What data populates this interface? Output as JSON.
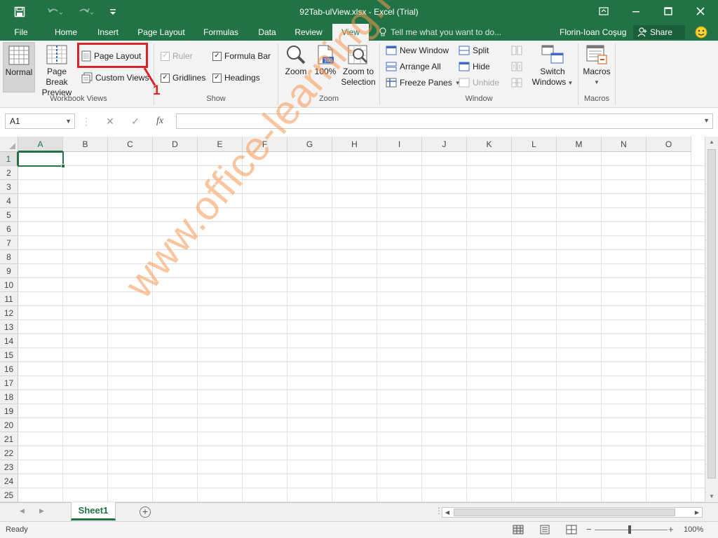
{
  "window": {
    "title": "92Tab-ulView.xlsx - Excel (Trial)"
  },
  "tabs": [
    {
      "label": "File"
    },
    {
      "label": "Home"
    },
    {
      "label": "Insert"
    },
    {
      "label": "Page Layout"
    },
    {
      "label": "Formulas"
    },
    {
      "label": "Data"
    },
    {
      "label": "Review"
    },
    {
      "label": "View"
    }
  ],
  "active_tab": "View",
  "tellme": {
    "placeholder": "Tell me what you want to do..."
  },
  "user": {
    "name": "Florin-Ioan Coşug",
    "share_label": "Share"
  },
  "ribbon": {
    "workbook_views": {
      "label": "Workbook Views",
      "normal": "Normal",
      "page_break_line1": "Page Break",
      "page_break_line2": "Preview",
      "page_layout": "Page Layout",
      "custom_views": "Custom Views"
    },
    "show": {
      "label": "Show",
      "ruler": "Ruler",
      "formula_bar": "Formula Bar",
      "gridlines": "Gridlines",
      "headings": "Headings"
    },
    "zoom": {
      "label": "Zoom",
      "zoom": "Zoom",
      "hundred": "100%",
      "hundred_icon_text": "100",
      "zoom_sel_line1": "Zoom to",
      "zoom_sel_line2": "Selection"
    },
    "window": {
      "label": "Window",
      "new_window": "New Window",
      "arrange_all": "Arrange All",
      "freeze_panes": "Freeze Panes",
      "split": "Split",
      "hide": "Hide",
      "unhide": "Unhide",
      "switch_line1": "Switch",
      "switch_line2": "Windows"
    },
    "macros": {
      "label": "Macros",
      "macros": "Macros"
    }
  },
  "annotation": {
    "number": "1",
    "color": "#d9242b"
  },
  "formula_bar": {
    "name_box": "A1",
    "fx": "fx",
    "value": ""
  },
  "grid": {
    "columns": [
      "A",
      "B",
      "C",
      "D",
      "E",
      "F",
      "G",
      "H",
      "I",
      "J",
      "K",
      "L",
      "M",
      "N",
      "O"
    ],
    "rows": [
      "1",
      "2",
      "3",
      "4",
      "5",
      "6",
      "7",
      "8",
      "9",
      "10",
      "11",
      "12",
      "13",
      "14",
      "15",
      "16",
      "17",
      "18",
      "19",
      "20",
      "21",
      "22",
      "23",
      "24",
      "25"
    ],
    "active_cell": "A1"
  },
  "watermark": "www.office-learning.ro",
  "sheets": [
    {
      "name": "Sheet1"
    }
  ],
  "status": {
    "text": "Ready",
    "zoom": "100%"
  },
  "colors": {
    "accent": "#217346",
    "annotation": "#d9242b",
    "watermark": "#f5a050"
  }
}
